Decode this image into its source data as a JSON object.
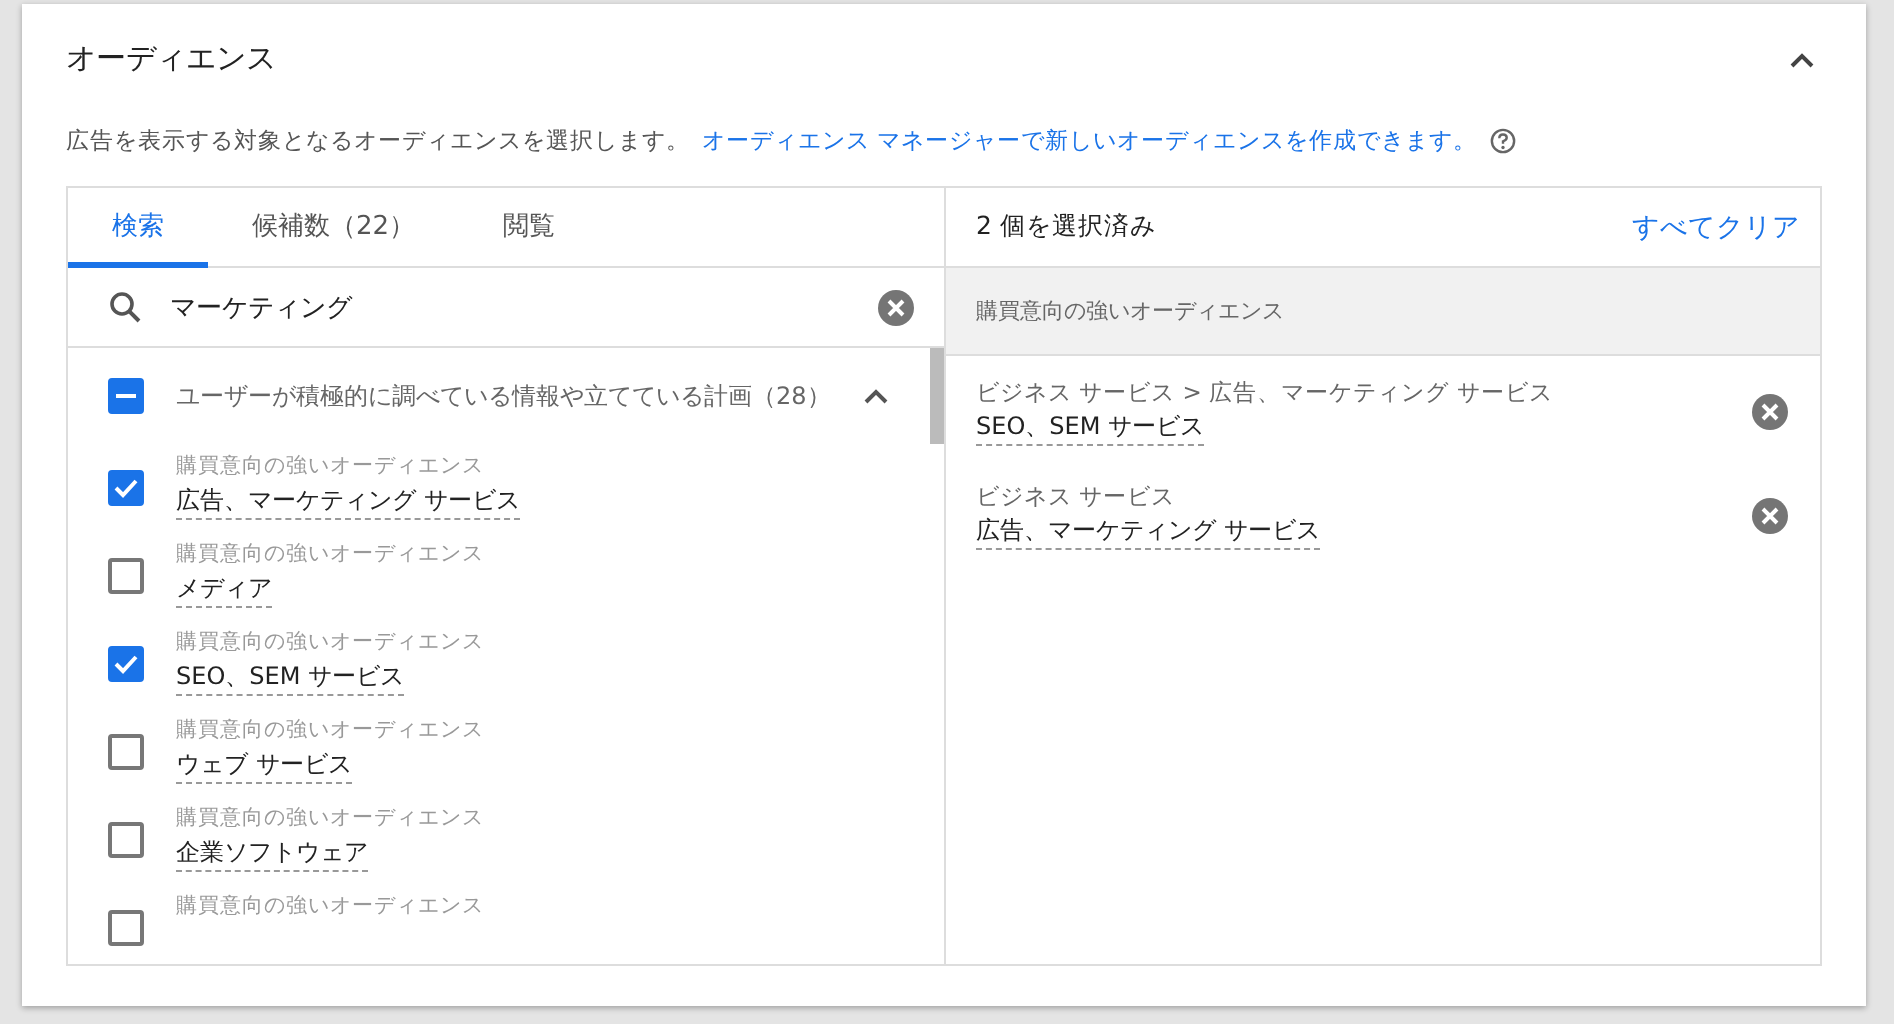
{
  "section": {
    "title": "オーディエンス",
    "expanded": true,
    "description": "広告を表示する対象となるオーディエンスを選択します。",
    "link": "オーディエンス マネージャーで新しいオーディエンスを作成できます。"
  },
  "tabs": [
    {
      "label": "検索",
      "selected": true
    },
    {
      "label": "候補数（22）",
      "selected": false
    },
    {
      "label": "閲覧",
      "selected": false
    }
  ],
  "search": {
    "value": "マーケティング"
  },
  "group": {
    "label": "ユーザーが積極的に調べている情報や立てている計画（28）",
    "indeterminate": true,
    "expanded": true
  },
  "items": [
    {
      "category": "購買意向の強いオーディエンス",
      "name": "広告、マーケティング サービス",
      "checked": true
    },
    {
      "category": "購買意向の強いオーディエンス",
      "name": "メディア",
      "checked": false
    },
    {
      "category": "購買意向の強いオーディエンス",
      "name": "SEO、SEM サービス",
      "checked": true
    },
    {
      "category": "購買意向の強いオーディエンス",
      "name": "ウェブ サービス",
      "checked": false
    },
    {
      "category": "購買意向の強いオーディエンス",
      "name": "企業ソフトウェア",
      "checked": false
    },
    {
      "category": "購買意向の強いオーディエンス",
      "checked": false
    }
  ],
  "selected_panel": {
    "count": "2 個を選択済み",
    "clear": "すべてクリア",
    "group": "購買意向の強いオーディエンス",
    "items": [
      {
        "path": "ビジネス サービス > 広告、マーケティング サービス",
        "name": "SEO、SEM サービス"
      },
      {
        "path": "ビジネス サービス",
        "name": "広告、マーケティング サービス"
      }
    ]
  }
}
